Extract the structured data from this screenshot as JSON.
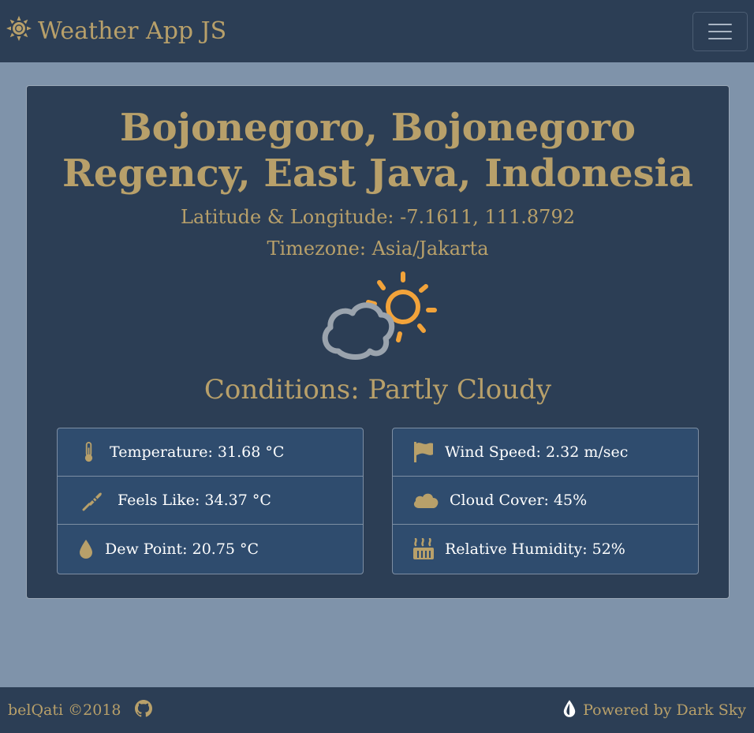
{
  "navbar": {
    "brand_icon": "sun-icon",
    "brand_text": "Weather App JS",
    "toggler_icon": "hamburger-menu-icon"
  },
  "location": {
    "name": "Bojonegoro, Bojonegoro Regency, East Java, Indonesia",
    "latlng": "Latitude & Longitude: -7.1611, 111.8792",
    "timezone": "Timezone: Asia/Jakarta"
  },
  "weather": {
    "icon": "partly-cloudy-day-icon",
    "conditions": "Conditions: Partly Cloudy"
  },
  "details_left": [
    {
      "icon": "thermometer-icon",
      "text": "Temperature: 31.68 °C"
    },
    {
      "icon": "thermometer-feather-icon",
      "text": "Feels Like: 34.37 °C"
    },
    {
      "icon": "droplet-icon",
      "text": "Dew Point: 20.75 °C"
    }
  ],
  "details_right": [
    {
      "icon": "flag-icon",
      "text": "Wind Speed: 2.32 m/sec"
    },
    {
      "icon": "cloud-icon",
      "text": "Cloud Cover: 45%"
    },
    {
      "icon": "humidity-icon",
      "text": "Relative Humidity: 52%"
    }
  ],
  "footer": {
    "credit": "belQati ©2018",
    "github_icon": "github-icon",
    "darksky_icon": "dark-sky-drop-icon",
    "powered_by": "Powered by Dark Sky"
  },
  "colors": {
    "background": "#7f93aa",
    "panel": "#2c3e55",
    "list_bg": "#2f4c6e",
    "accent_gold": "#b8a06a",
    "sun_orange": "#f2a33a",
    "cloud_grey": "#9aa3ad"
  }
}
